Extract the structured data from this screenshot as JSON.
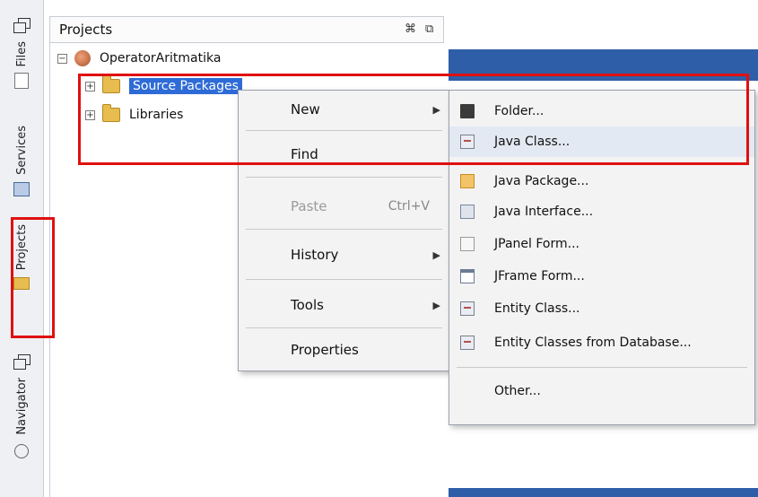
{
  "side_tabs": [
    {
      "label": "Files"
    },
    {
      "label": "Services"
    },
    {
      "label": "Projects"
    },
    {
      "label": "Navigator"
    }
  ],
  "panel": {
    "title": "Projects",
    "close_glyph": "⌘",
    "restore_glyph": "⧉"
  },
  "tree": {
    "project": "OperatorAritmatika",
    "nodes": [
      {
        "label": "Source Packages",
        "selected": true
      },
      {
        "label": "Libraries",
        "selected": false
      }
    ]
  },
  "context_menu": {
    "items": [
      {
        "label": "New",
        "submenu": true,
        "enabled": true
      },
      {
        "label": "Find",
        "enabled": true
      },
      {
        "label": "Paste",
        "shortcut": "Ctrl+V",
        "enabled": false
      },
      {
        "label": "History",
        "submenu": true,
        "enabled": true
      },
      {
        "label": "Tools",
        "submenu": true,
        "enabled": true
      },
      {
        "label": "Properties",
        "enabled": true
      }
    ]
  },
  "submenu": {
    "items": [
      {
        "label": "Folder...",
        "icon": "folder-icon"
      },
      {
        "label": "Java Class...",
        "icon": "java-class-icon"
      },
      {
        "label": "Java Package...",
        "icon": "package-icon"
      },
      {
        "label": "Java Interface...",
        "icon": "interface-icon"
      },
      {
        "label": "JPanel Form...",
        "icon": "panel-form-icon"
      },
      {
        "label": "JFrame Form...",
        "icon": "frame-form-icon"
      },
      {
        "label": "Entity Class...",
        "icon": "entity-icon"
      },
      {
        "label": "Entity Classes from Database...",
        "icon": "entity-db-icon"
      },
      {
        "label": "Other...",
        "icon": ""
      }
    ]
  },
  "colors": {
    "highlight_box": "#e01010",
    "selection": "#2e6bd6",
    "band": "#2f5ea8"
  }
}
